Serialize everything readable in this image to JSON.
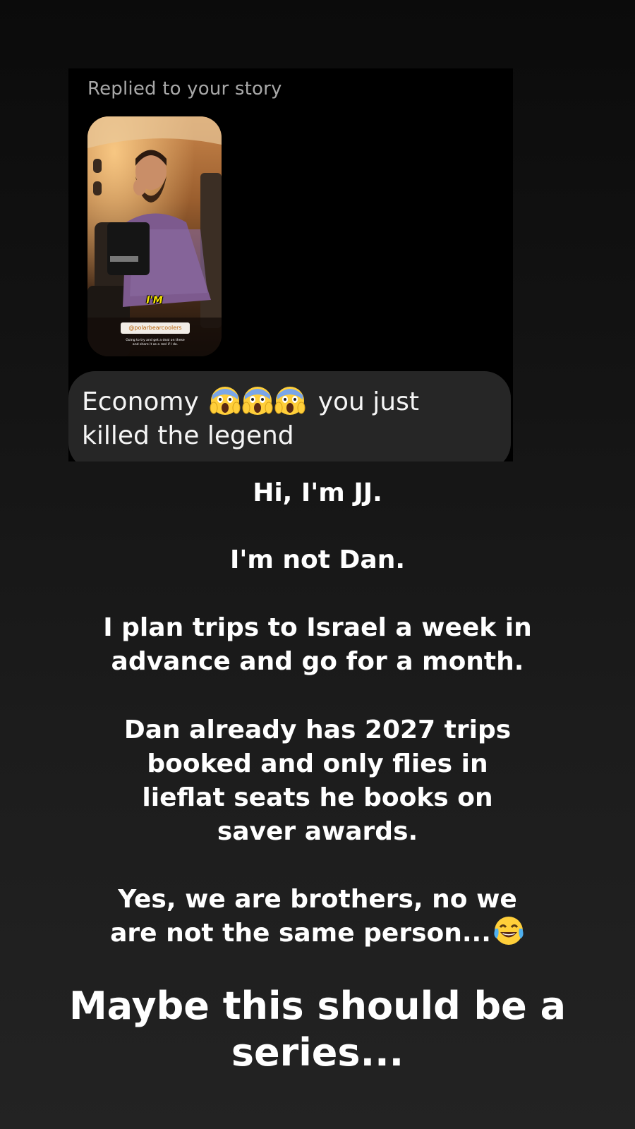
{
  "dm": {
    "replied_label": "Replied to your story",
    "message": {
      "before": "Economy",
      "emojis": [
        "scream",
        "scream",
        "scream"
      ],
      "after": "you just killed the legend"
    }
  },
  "story_thumbnail": {
    "overlay_word": "I'M",
    "handle": "@polarbearcoolers",
    "caption": "Going to try and get a deal on these and share it as a reel if I do."
  },
  "story_text": {
    "line1": "Hi, I'm JJ.",
    "line2": "I'm not Dan.",
    "para3_l1": "I plan trips to Israel a week in",
    "para3_l2": "advance and go for a month.",
    "para4_l1": "Dan already has 2027 trips",
    "para4_l2": "booked and only flies in",
    "para4_l3": "lieflat seats he books on",
    "para4_l4": "saver awards.",
    "para5_l1": "Yes, we are brothers, no we",
    "para5_l2": "are not the same person...",
    "para5_emoji": "laughing-tears",
    "big_l1": "Maybe this should be a",
    "big_l2": "series..."
  }
}
